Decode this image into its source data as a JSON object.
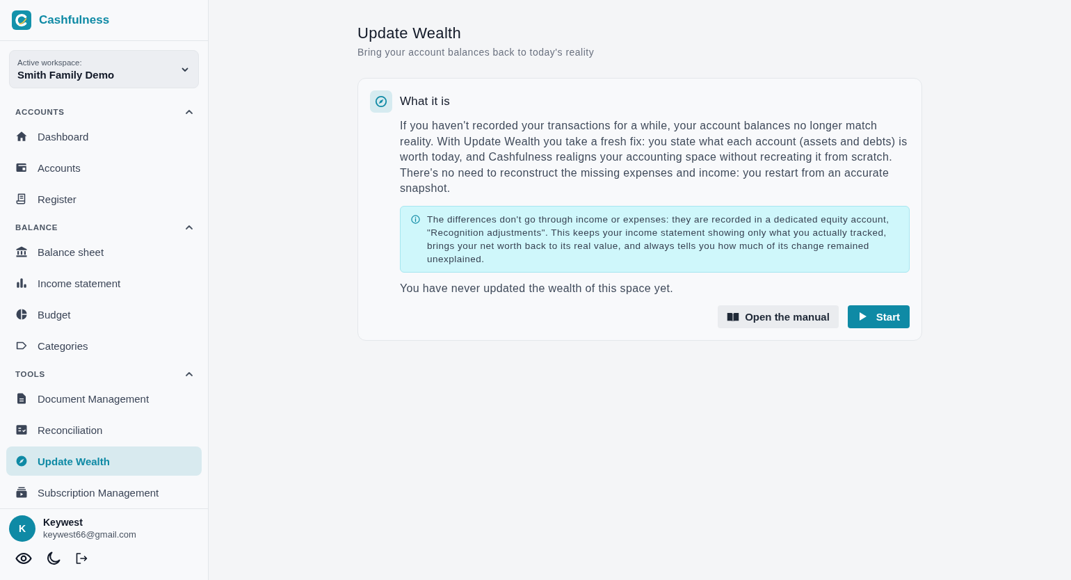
{
  "sidebar": {
    "brand": "Cashfulness",
    "workspace": {
      "caption": "Active workspace:",
      "name": "Smith Family Demo"
    },
    "sections": [
      {
        "title": "ACCOUNTS",
        "expanded": true,
        "items": [
          {
            "label": "Dashboard",
            "selected": false
          },
          {
            "label": "Accounts",
            "selected": false
          },
          {
            "label": "Register",
            "selected": false
          }
        ]
      },
      {
        "title": "BALANCE",
        "expanded": true,
        "items": [
          {
            "label": "Balance sheet",
            "selected": false
          },
          {
            "label": "Income statement",
            "selected": false
          },
          {
            "label": "Budget",
            "selected": false
          },
          {
            "label": "Categories",
            "selected": false
          }
        ]
      },
      {
        "title": "TOOLS",
        "expanded": true,
        "items": [
          {
            "label": "Document Management",
            "selected": false
          },
          {
            "label": "Reconciliation",
            "selected": false
          },
          {
            "label": "Update Wealth",
            "selected": true
          },
          {
            "label": "Subscription Management",
            "selected": false
          }
        ]
      }
    ],
    "user": {
      "initial": "K",
      "name": "Keywest",
      "email": "keywest66@gmail.com"
    }
  },
  "page": {
    "title": "Update Wealth",
    "subtitle": "Bring your account balances back to today's reality"
  },
  "card": {
    "title": "What it is",
    "description": "If you haven't recorded your transactions for a while, your account balances no longer match reality. With Update Wealth you take a fresh fix: you state what each account (assets and debts) is worth today, and Cashfulness realigns your accounting space without recreating it from scratch. There's no need to reconstruct the missing expenses and income: you restart from an accurate snapshot.",
    "note": "The differences don't go through income or expenses: they are recorded in a dedicated equity account, \"Recognition adjustments\". This keeps your income statement showing only what you actually tracked, brings your net worth back to its real value, and always tells you how much of its change remained unexplained.",
    "status": "You have never updated the wealth of this space yet.",
    "buttons": [
      {
        "label": "Open the manual",
        "kind": "secondary"
      },
      {
        "label": "Start",
        "kind": "primary"
      }
    ]
  }
}
